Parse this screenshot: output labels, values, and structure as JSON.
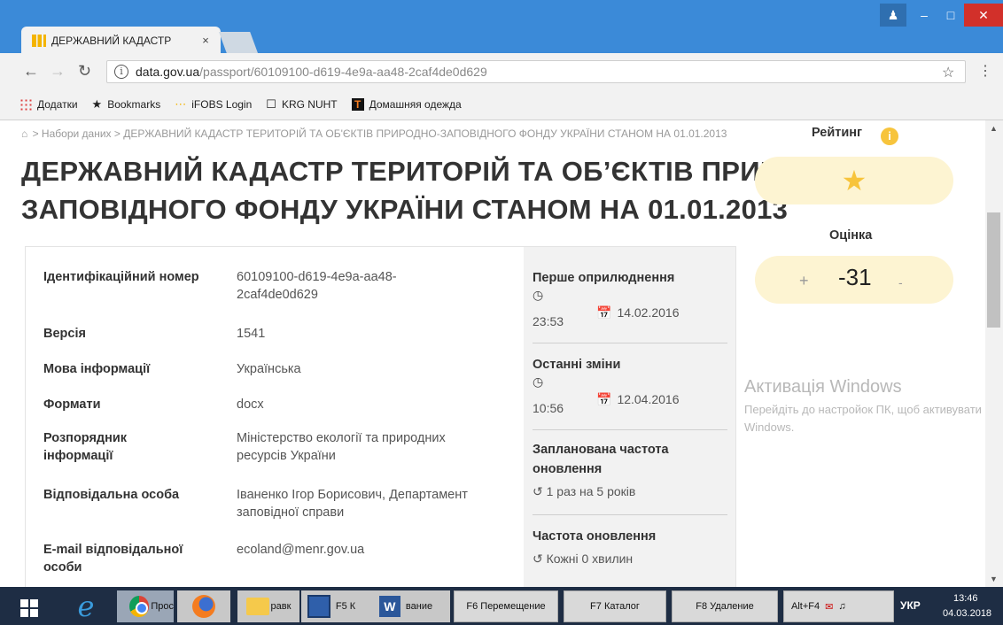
{
  "browser": {
    "tab_title": "ДЕРЖАВНИЙ КАДАСТР",
    "tab_close": "×",
    "url_host": "data.gov.ua",
    "url_path": "/passport/60109100-d619-4e9a-aa48-2caf4de0d629",
    "bookmarks": [
      {
        "label": "Додатки",
        "icon": "apps-icon"
      },
      {
        "label": "Bookmarks",
        "icon": "star-icon"
      },
      {
        "label": "iFOBS Login",
        "icon": "loading-icon"
      },
      {
        "label": "KRG NUHT",
        "icon": "page-icon"
      },
      {
        "label": "Домашняя одежда",
        "icon": "t-logo-icon"
      }
    ]
  },
  "page": {
    "breadcrumb": "> Набори даних > ДЕРЖАВНИЙ КАДАСТР ТЕРИТОРІЙ ТА ОБ'ЄКТІВ ПРИРОДНО-ЗАПОВІДНОГО ФОНДУ УКРАЇНИ СТАНОМ НА 01.01.2013",
    "title": "ДЕРЖАВНИЙ КАДАСТР ТЕРИТОРІЙ ТА ОБ’ЄКТІВ ПРИРОДНО-ЗАПОВІДНОГО ФОНДУ УКРАЇНИ СТАНОМ НА 01.01.2013"
  },
  "info": {
    "id_label": "Ідентифікаційний номер",
    "id_value": "60109100-d619-4e9a-aa48-2caf4de0d629",
    "version_label": "Версія",
    "version_value": "1541",
    "lang_label": "Мова інформації",
    "lang_value": "Українська",
    "formats_label": "Формати",
    "formats_value": "docx",
    "owner_label": "Розпорядник інформації",
    "owner_value": "Міністерство екології та природних ресурсів України",
    "person_label": "Відповідальна особа",
    "person_value": "Іваненко Ігор Борисович, Департамент заповідної справи",
    "email_label": "E-mail відповідальної особи",
    "email_value": "ecoland@menr.gov.ua"
  },
  "dates": {
    "first_pub_label": "Перше оприлюднення",
    "first_pub_time": "23:53",
    "first_pub_date": "14.02.2016",
    "last_change_label": "Останні зміни",
    "last_change_time": "10:56",
    "last_change_date": "12.04.2016",
    "planned_freq_label": "Запланована частота оновлення",
    "planned_freq_value": "1 раз на 5 років",
    "freq_label": "Частота оновлення",
    "freq_value": "Кожні 0 хвилин"
  },
  "rating": {
    "label": "Рейтинг",
    "score_label": "Оцінка",
    "score_value": "-31",
    "plus": "+",
    "minus": "-"
  },
  "activation": {
    "title": "Активація Windows",
    "text": "Перейдіть до настройок ПК, щоб активувати Windows."
  },
  "taskbar": {
    "chrome_label": "Прос",
    "folder_label": "равк",
    "f5_label": "F5 К",
    "word_label": "вание",
    "f6_label": "F6 Перемещение",
    "f7_label": "F7 Каталог",
    "f8_label": "F8 Удаление",
    "tray_label": "Alt+F4",
    "lang": "УКР",
    "time": "13:46",
    "date": "04.03.2018"
  },
  "colors": {
    "accent": "#f7c43c",
    "pill_bg": "#fdf4d2",
    "titlebar": "#3b8ad8",
    "close_btn": "#d2302a"
  }
}
